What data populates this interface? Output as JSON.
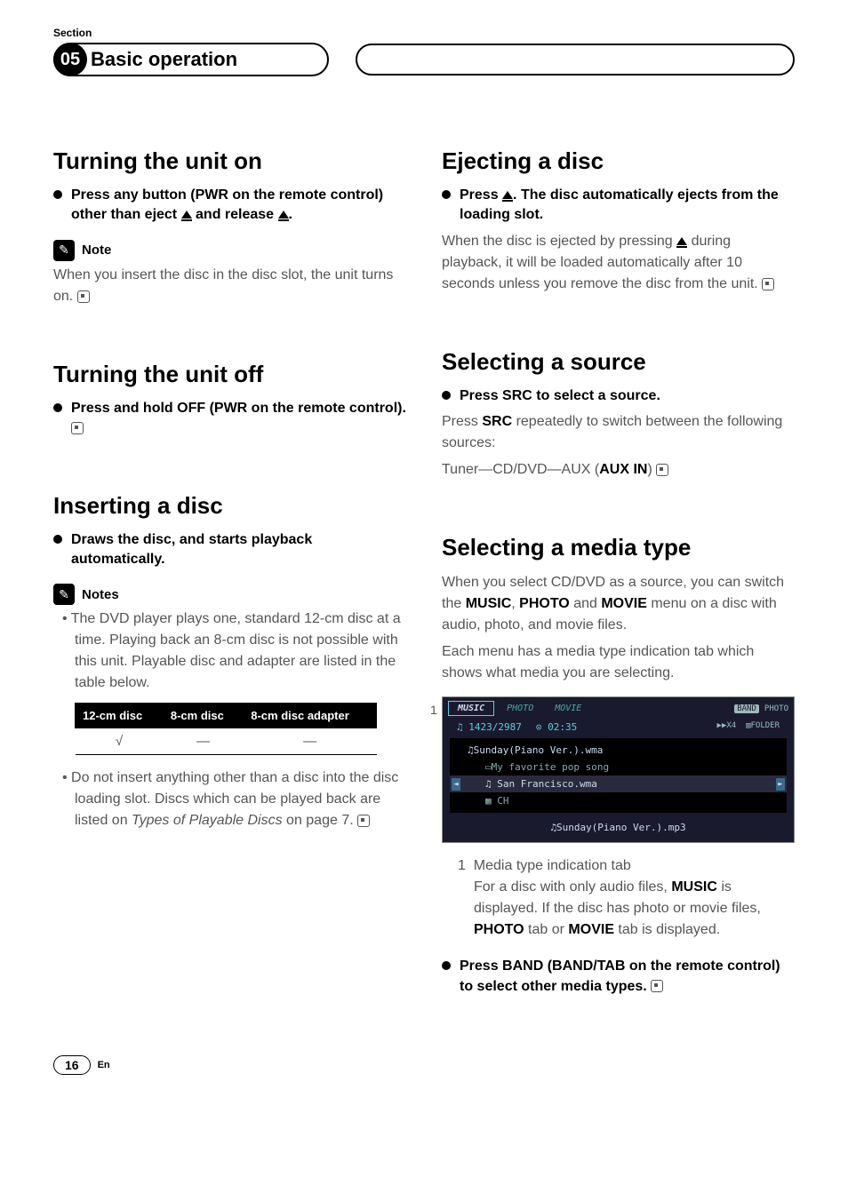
{
  "header": {
    "section_label": "Section",
    "section_num": "05",
    "title": "Basic operation"
  },
  "left": {
    "s1": {
      "heading": "Turning the unit on",
      "bullet_a": "Press any button (PWR on the remote control) other than eject ",
      "bullet_b": " and release ",
      "bullet_c": ".",
      "note_label": "Note",
      "note_text": "When you insert the disc in the disc slot, the unit turns on."
    },
    "s2": {
      "heading": "Turning the unit off",
      "bullet": "Press and hold OFF (PWR on the remote control)."
    },
    "s3": {
      "heading": "Inserting a disc",
      "bullet": "Draws the disc, and starts playback automatically.",
      "notes_label": "Notes",
      "note1": "• The DVD player plays one, standard 12-cm disc at a time. Playing back an 8-cm disc is not possible with this unit. Playable disc and adapter are listed in the table below.",
      "table": {
        "h1": "12-cm disc",
        "h2": "8-cm disc",
        "h3": "8-cm disc adapter",
        "c1": "√",
        "c2": "—",
        "c3": "—"
      },
      "note2_a": "• Do not insert anything other than a disc into the disc loading slot. Discs which can be played back are listed on ",
      "note2_b": "Types of Playable Discs",
      "note2_c": " on page 7."
    }
  },
  "right": {
    "s1": {
      "heading": "Ejecting a disc",
      "bullet_a": "Press ",
      "bullet_b": ". The disc automatically ejects from the loading slot.",
      "body_a": "When the disc is ejected by pressing ",
      "body_b": " during playback, it will be loaded automatically after 10 seconds unless you remove the disc from the unit."
    },
    "s2": {
      "heading": "Selecting a source",
      "bullet": "Press SRC to select a source.",
      "body_a": "Press ",
      "body_b": "SRC",
      "body_c": " repeatedly to switch between the following sources:",
      "body_d_a": "Tuner—CD/DVD—AUX (",
      "body_d_b": "AUX IN",
      "body_d_c": ")"
    },
    "s3": {
      "heading": "Selecting a media type",
      "body1_a": "When you select CD/DVD as a source, you can switch the ",
      "body1_b": "MUSIC",
      "body1_c": ", ",
      "body1_d": "PHOTO",
      "body1_e": " and ",
      "body1_f": "MOVIE",
      "body1_g": " menu on a disc with audio, photo, and movie files.",
      "body2": "Each menu has a media type indication tab which shows what media you are selecting.",
      "screenshot": {
        "callout": "1",
        "tab1": "MUSIC",
        "tab2": "PHOTO",
        "tab3": "MOVIE",
        "band": "BAND",
        "right1": "PHOTO",
        "counter": "♫ 1423/2987",
        "time": "⊙ 02:35",
        "speed": "▶▶X4",
        "folder": "▥FOLDER",
        "row1": "♫Sunday(Piano Ver.).wma",
        "row2": "▭My favorite pop song",
        "row3": "♫ San Francisco.wma",
        "row4": "▦ CH",
        "now": "♫Sunday(Piano Ver.).mp3"
      },
      "caption_num": "1",
      "caption_title": "Media type indication tab",
      "caption_a": "For a disc with only audio files, ",
      "caption_b": "MUSIC",
      "caption_c": " is displayed. If the disc has photo or movie files, ",
      "caption_d": "PHOTO",
      "caption_e": " tab or ",
      "caption_f": "MOVIE",
      "caption_g": " tab is displayed.",
      "bullet2": "Press BAND (BAND/TAB on the remote control) to select other media types."
    }
  },
  "footer": {
    "page": "16",
    "lang": "En"
  }
}
